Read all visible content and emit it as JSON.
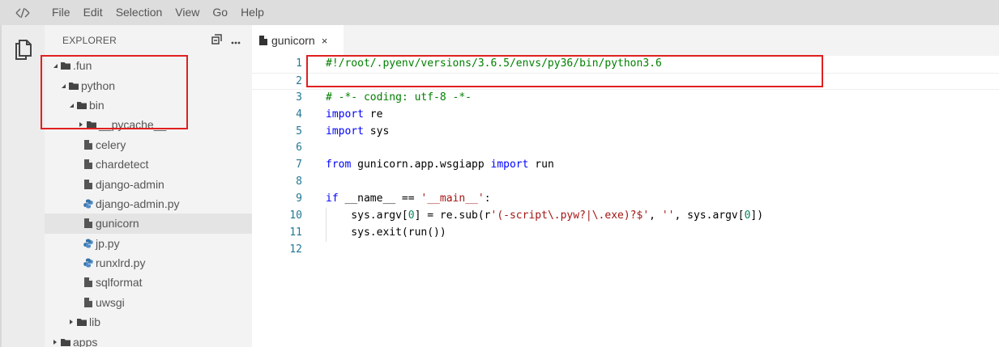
{
  "menubar": {
    "logo_icon": "theia-logo-icon",
    "items": [
      "File",
      "Edit",
      "Selection",
      "View",
      "Go",
      "Help"
    ]
  },
  "activitybar": {
    "explorer_icon": "files-icon"
  },
  "explorer": {
    "title": "EXPLORER",
    "actions": [
      "collapse-all-icon",
      "more-icon"
    ],
    "tree": [
      {
        "label": ".fun",
        "level": 0,
        "type": "folder",
        "expanded": true
      },
      {
        "label": "python",
        "level": 1,
        "type": "folder",
        "expanded": true
      },
      {
        "label": "bin",
        "level": 2,
        "type": "folder",
        "expanded": true
      },
      {
        "label": "__pycache__",
        "level": 3,
        "type": "folder",
        "expanded": false
      },
      {
        "label": "celery",
        "level": 3,
        "type": "file"
      },
      {
        "label": "chardetect",
        "level": 3,
        "type": "file"
      },
      {
        "label": "django-admin",
        "level": 3,
        "type": "file"
      },
      {
        "label": "django-admin.py",
        "level": 3,
        "type": "python"
      },
      {
        "label": "gunicorn",
        "level": 3,
        "type": "file",
        "selected": true
      },
      {
        "label": "jp.py",
        "level": 3,
        "type": "python"
      },
      {
        "label": "runxlrd.py",
        "level": 3,
        "type": "python"
      },
      {
        "label": "sqlformat",
        "level": 3,
        "type": "file"
      },
      {
        "label": "uwsgi",
        "level": 3,
        "type": "file"
      },
      {
        "label": "lib",
        "level": 2,
        "type": "folder",
        "expanded": false
      },
      {
        "label": "apps",
        "level": 0,
        "type": "folder",
        "expanded": false
      }
    ]
  },
  "editor": {
    "tab": {
      "label": "gunicorn",
      "close": "×"
    },
    "lines": [
      {
        "n": "1",
        "tokens": [
          {
            "t": "#!/root/.pyenv/versions/3.6.5/envs/py36/bin/python3.6",
            "c": "comment"
          }
        ]
      },
      {
        "n": "2",
        "tokens": []
      },
      {
        "n": "3",
        "tokens": [
          {
            "t": "# -*- coding: utf-8 -*-",
            "c": "comment"
          }
        ]
      },
      {
        "n": "4",
        "tokens": [
          {
            "t": "import",
            "c": "keyword"
          },
          {
            "t": " re",
            "c": "plain"
          }
        ]
      },
      {
        "n": "5",
        "tokens": [
          {
            "t": "import",
            "c": "keyword"
          },
          {
            "t": " sys",
            "c": "plain"
          }
        ]
      },
      {
        "n": "6",
        "tokens": []
      },
      {
        "n": "7",
        "tokens": [
          {
            "t": "from",
            "c": "keyword"
          },
          {
            "t": " gunicorn.app.wsgiapp ",
            "c": "plain"
          },
          {
            "t": "import",
            "c": "keyword"
          },
          {
            "t": " run",
            "c": "plain"
          }
        ]
      },
      {
        "n": "8",
        "tokens": []
      },
      {
        "n": "9",
        "tokens": [
          {
            "t": "if",
            "c": "keyword"
          },
          {
            "t": " __name__ == ",
            "c": "plain"
          },
          {
            "t": "'__main__'",
            "c": "string"
          },
          {
            "t": ":",
            "c": "plain"
          }
        ]
      },
      {
        "n": "10",
        "tokens": [
          {
            "t": "    sys.argv[",
            "c": "plain"
          },
          {
            "t": "0",
            "c": "number"
          },
          {
            "t": "] = re.sub(r",
            "c": "plain"
          },
          {
            "t": "'(-script\\.pyw?|\\.exe)?$'",
            "c": "string"
          },
          {
            "t": ", ",
            "c": "plain"
          },
          {
            "t": "''",
            "c": "string"
          },
          {
            "t": ", sys.argv[",
            "c": "plain"
          },
          {
            "t": "0",
            "c": "number"
          },
          {
            "t": "])",
            "c": "plain"
          }
        ]
      },
      {
        "n": "11",
        "tokens": [
          {
            "t": "    sys.exit(run())",
            "c": "plain"
          }
        ]
      },
      {
        "n": "12",
        "tokens": []
      }
    ]
  },
  "colors": {
    "annotation": "#e02020",
    "comment": "#008000",
    "keyword": "#0000ff",
    "string": "#a31515",
    "number": "#098658",
    "line_number": "#237893"
  }
}
